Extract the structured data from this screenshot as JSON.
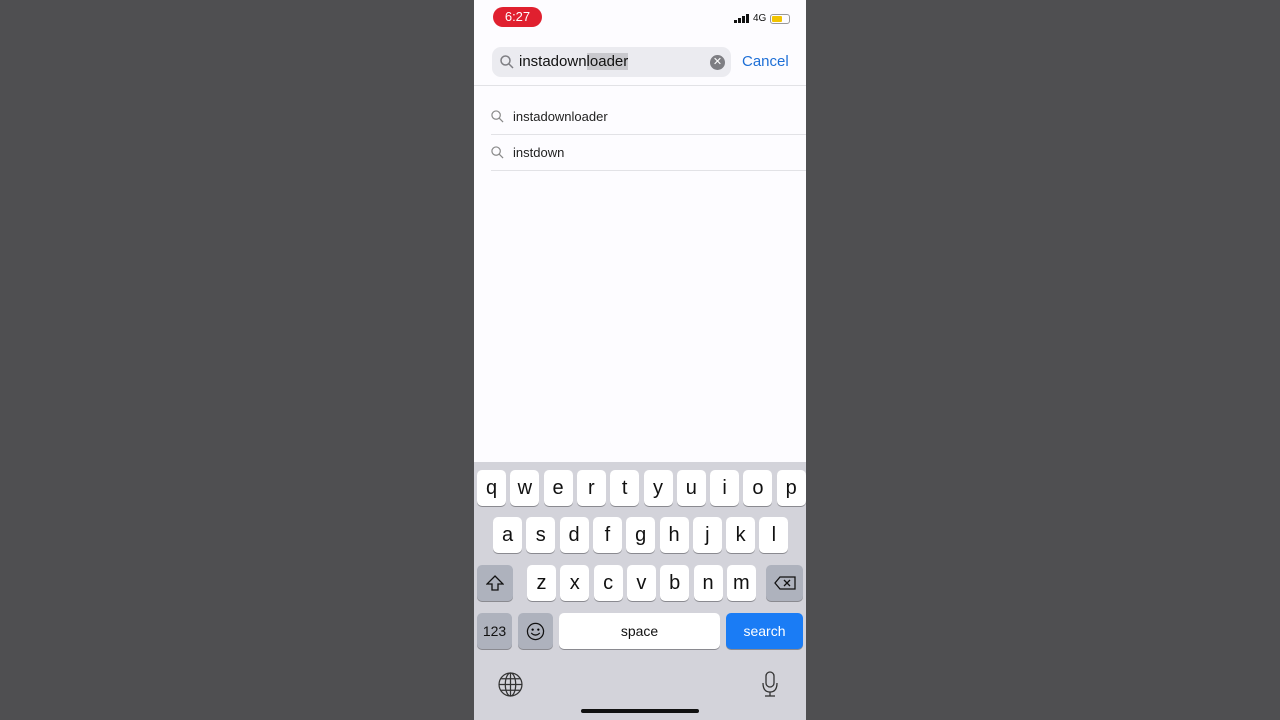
{
  "status": {
    "time": "6:27",
    "network": "4G",
    "battery_level": 0.6
  },
  "search": {
    "value_prefix": "instadown",
    "value_selected": "loader",
    "cancel_label": "Cancel"
  },
  "suggestions": [
    {
      "label": "instadownloader"
    },
    {
      "label": "instdown"
    }
  ],
  "keyboard": {
    "row1": [
      "q",
      "w",
      "e",
      "r",
      "t",
      "y",
      "u",
      "i",
      "o",
      "p"
    ],
    "row2": [
      "a",
      "s",
      "d",
      "f",
      "g",
      "h",
      "j",
      "k",
      "l"
    ],
    "row3": [
      "z",
      "x",
      "c",
      "v",
      "b",
      "n",
      "m"
    ],
    "numbers_label": "123",
    "space_label": "space",
    "search_label": "search"
  },
  "colors": {
    "accent": "#1a7cf5",
    "time_badge": "#e0202f"
  }
}
